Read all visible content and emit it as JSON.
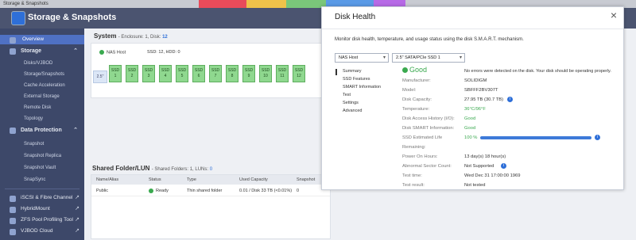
{
  "window": {
    "title": "Storage & Snapshots"
  },
  "header": {
    "title": "Storage & Snapshots"
  },
  "sidebar": {
    "overview": "Overview",
    "storage": "Storage",
    "storage_items": [
      "Disks/VJBOD",
      "Storage/Snapshots",
      "Cache Acceleration",
      "External Storage",
      "Remote Disk",
      "Topology"
    ],
    "data_protection": "Data Protection",
    "dp_items": [
      "Snapshot",
      "Snapshot Replica",
      "Snapshot Vault",
      "SnapSync"
    ],
    "bottom_items": [
      "iSCSI & Fibre Channel",
      "HybridMount",
      "ZFS Pool Profiling Tool",
      "VJBOD Cloud"
    ]
  },
  "system": {
    "title": "System",
    "meta_prefix": "- Enclosure: 1, Disk: ",
    "disk_count": "12",
    "nas_host": "NAS Host",
    "ssd_hdd": "SSD: 12, HDD: 0",
    "bay_label": "2.5\"",
    "ssd_label": "SSD",
    "ssd_slots": [
      "1",
      "2",
      "3",
      "4",
      "5",
      "6",
      "7",
      "8",
      "9",
      "10",
      "11",
      "12"
    ]
  },
  "shared": {
    "title": "Shared Folder/LUN",
    "meta_prefix": "- Shared Folders: 1, LUNs: ",
    "lun_count": "0",
    "columns": [
      "Name/Alias",
      "Status",
      "Type",
      "Used Capacity",
      "Snapshot"
    ],
    "row": {
      "name": "Public",
      "status": "Ready",
      "type": "Thin shared folder",
      "used": "0.01 / Disk 33 TB (<0.01%)",
      "snapshot": "0"
    }
  },
  "modal": {
    "title": "Disk Health",
    "close": "×",
    "description": "Monitor disk health, temperature, and usage status using the disk S.M.A.R.T. mechanism.",
    "host_select": "NAS Host",
    "disk_select": "2.5\" SATA/PCIe SSD 1",
    "nav": [
      "Summary",
      "SSD Features",
      "SMART Information",
      "Test",
      "Settings",
      "Advanced"
    ],
    "status_word": "Good",
    "status_message": "No errors were detected on the disk. Your disk should be operating properly.",
    "fields": [
      {
        "label": "Manufacturer:",
        "value": "SOLIDIGM"
      },
      {
        "label": "Model:",
        "value": "SBFFF2BV307T"
      },
      {
        "label": "Disk Capacity:",
        "value": "27.95 TB (30.7 TB)"
      },
      {
        "label": "Temperature:",
        "value": "36°C/96°F"
      },
      {
        "label": "Disk Access History (I/O):",
        "value": "Good"
      },
      {
        "label": "Disk SMART Information:",
        "value": "Good"
      },
      {
        "label": "SSD Estimated Life",
        "value": "100 %"
      },
      {
        "label": "Remaining:",
        "value": ""
      },
      {
        "label": "Power On Hours:",
        "value": "13 day(s) 18 hour(s)"
      },
      {
        "label": "Abnormal Sector Count:",
        "value": "Not Supported"
      },
      {
        "label": "Test time:",
        "value": "Wed Dec 31 17:00:00 1969"
      },
      {
        "label": "Test result:",
        "value": "Not tested"
      }
    ],
    "ssd_life_percent": 100
  },
  "colors": {
    "accent": "#2e6fd8",
    "good": "#3aa94f",
    "sidebar": "#3d4869",
    "header": "#4b5470"
  }
}
